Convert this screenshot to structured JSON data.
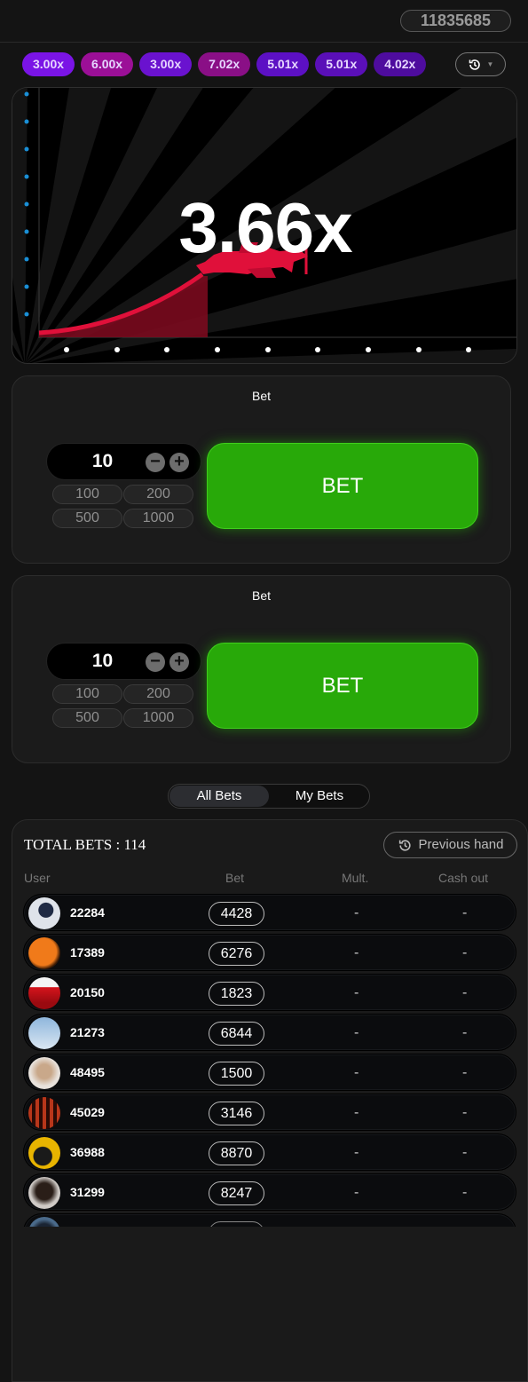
{
  "header": {
    "balance": "11835685"
  },
  "history": [
    {
      "label": "3.00x",
      "color": "#7a14e6"
    },
    {
      "label": "6.00x",
      "color": "#9b0f97"
    },
    {
      "label": "3.00x",
      "color": "#6a12cf"
    },
    {
      "label": "7.02x",
      "color": "#8a0f86"
    },
    {
      "label": "5.01x",
      "color": "#5c10c4"
    },
    {
      "label": "5.01x",
      "color": "#5a0fb8"
    },
    {
      "label": "4.02x",
      "color": "#4e0c9e"
    }
  ],
  "history_button": {
    "icon": "history-icon"
  },
  "game": {
    "multiplier": "3.66x",
    "accent_color": "#e0103a",
    "plane_icon": "plane-icon"
  },
  "bet_panels": [
    {
      "title": "Bet",
      "amount": "10",
      "quick": [
        "100",
        "200",
        "500",
        "1000"
      ],
      "bet_label": "BET"
    },
    {
      "title": "Bet",
      "amount": "10",
      "quick": [
        "100",
        "200",
        "500",
        "1000"
      ],
      "bet_label": "BET"
    }
  ],
  "tabs": {
    "all": "All Bets",
    "mine": "My Bets"
  },
  "bets": {
    "total_label": "TOTAL BETS : 114",
    "prev_hand": "Previous hand",
    "columns": {
      "user": "User",
      "bet": "Bet",
      "mult": "Mult.",
      "cashout": "Cash out"
    },
    "rows": [
      {
        "user": "22284",
        "bet": "4428",
        "mult": "-",
        "cashout": "-"
      },
      {
        "user": "17389",
        "bet": "6276",
        "mult": "-",
        "cashout": "-"
      },
      {
        "user": "20150",
        "bet": "1823",
        "mult": "-",
        "cashout": "-"
      },
      {
        "user": "21273",
        "bet": "6844",
        "mult": "-",
        "cashout": "-"
      },
      {
        "user": "48495",
        "bet": "1500",
        "mult": "-",
        "cashout": "-"
      },
      {
        "user": "45029",
        "bet": "3146",
        "mult": "-",
        "cashout": "-"
      },
      {
        "user": "36988",
        "bet": "8870",
        "mult": "-",
        "cashout": "-"
      },
      {
        "user": "31299",
        "bet": "8247",
        "mult": "-",
        "cashout": "-"
      }
    ]
  },
  "colors": {
    "bet_green": "#28a909",
    "background": "#141414"
  }
}
